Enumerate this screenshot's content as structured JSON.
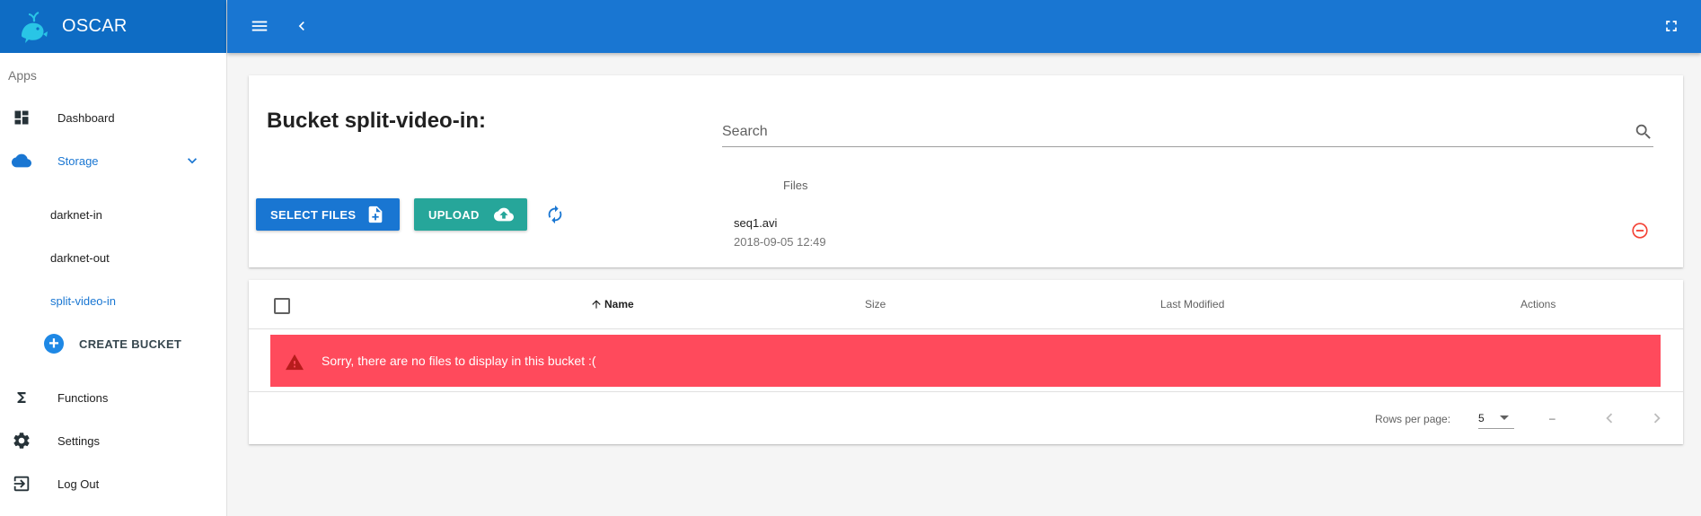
{
  "app": {
    "title": "OSCAR"
  },
  "sidebar": {
    "section_label": "Apps",
    "items": [
      {
        "label": "Dashboard",
        "icon": "dashboard-icon"
      },
      {
        "label": "Storage",
        "icon": "cloud-icon"
      },
      {
        "label": "Functions",
        "icon": "sigma-icon"
      },
      {
        "label": "Settings",
        "icon": "gear-icon"
      },
      {
        "label": "Log Out",
        "icon": "logout-icon"
      }
    ],
    "buckets": [
      "darknet-in",
      "darknet-out",
      "split-video-in"
    ],
    "active_bucket": "split-video-in",
    "create_bucket_label": "CREATE BUCKET"
  },
  "bucket": {
    "title_prefix": "Bucket ",
    "name": "split-video-in",
    "title_suffix": ":"
  },
  "search": {
    "placeholder": "Search",
    "value": ""
  },
  "actions": {
    "select_files_label": "SELECT FILES",
    "upload_label": "UPLOAD"
  },
  "upload_queue": {
    "header": "Files",
    "files": [
      {
        "name": "seq1.avi",
        "date": "2018-09-05 12:49"
      }
    ]
  },
  "table": {
    "columns": [
      "Name",
      "Size",
      "Last Modified",
      "Actions"
    ],
    "sorted_column": "Name",
    "empty_message": "Sorry, there are no files to display in this bucket :("
  },
  "pagination": {
    "rows_per_page_label": "Rows per page:",
    "rows_per_page": "5",
    "range": "–"
  },
  "colors": {
    "brand": "#0e6cc4",
    "topbar": "#1976d2",
    "primary": "#1976d2",
    "teal": "#26a69a",
    "alert": "#ff4a5c",
    "logo": "#29c5e6"
  }
}
